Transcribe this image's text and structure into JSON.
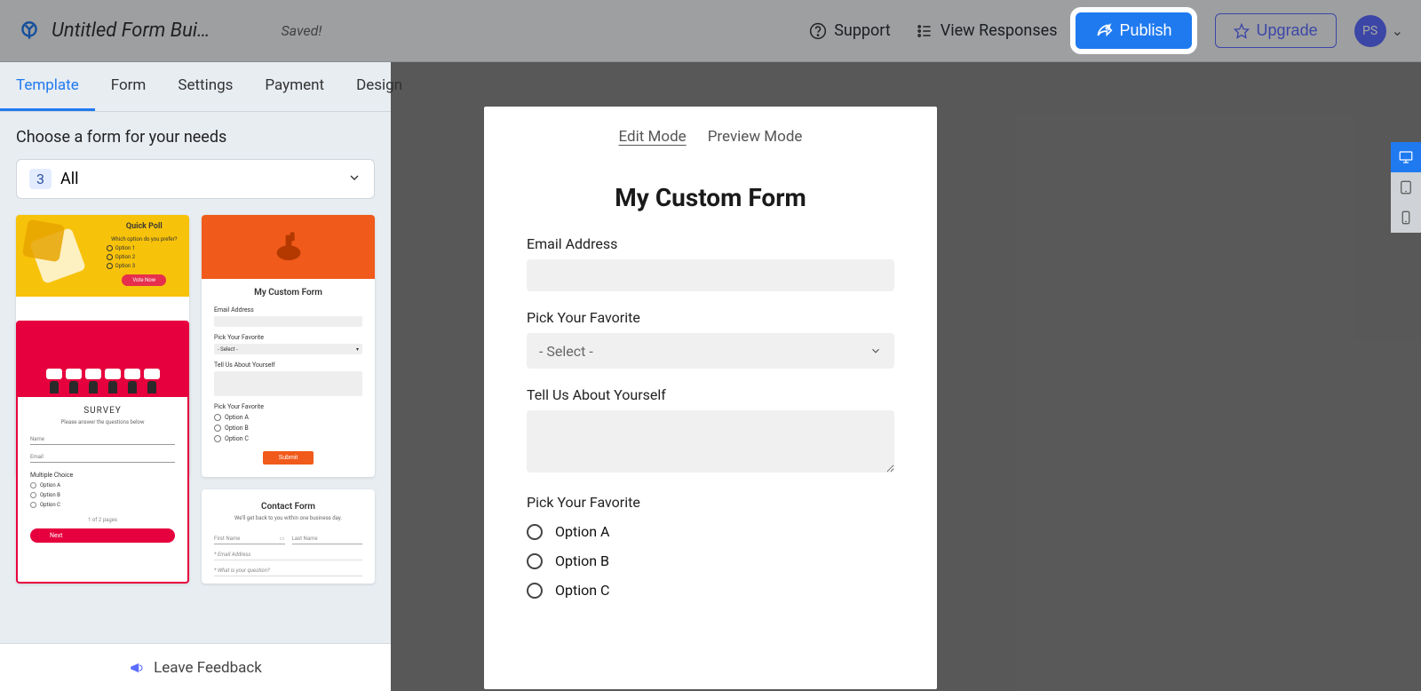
{
  "header": {
    "title": "Untitled Form Bui…",
    "saved": "Saved!",
    "support": "Support",
    "view_responses": "View Responses",
    "publish": "Publish",
    "upgrade": "Upgrade",
    "avatar_initials": "PS"
  },
  "sidebar": {
    "tabs": [
      "Template",
      "Form",
      "Settings",
      "Payment",
      "Design"
    ],
    "active_tab_index": 0,
    "section_title": "Choose a form for your needs",
    "filter": {
      "count": "3",
      "label": "All"
    },
    "templates": {
      "poll": {
        "title": "Quick Poll",
        "question": "Which option do you prefer?",
        "options": [
          "Option 1",
          "Option 2",
          "Option 3"
        ],
        "button": "Vote Now"
      },
      "custom": {
        "title": "My Custom Form",
        "f1": "Email Address",
        "f2": "Pick Your Favorite",
        "select_placeholder": "- Select -",
        "f3": "Tell Us About Yourself",
        "f4": "Pick Your Favorite",
        "radios": [
          "Option A",
          "Option B",
          "Option C"
        ],
        "submit": "Submit"
      },
      "survey": {
        "title": "SURVEY",
        "subtitle": "Please answer the questions below",
        "name": "Name",
        "email": "Email",
        "mc": "Multiple Choice",
        "radios": [
          "Option A",
          "Option B",
          "Option C"
        ],
        "pagination": "1 of 2 pages",
        "next": "Next"
      },
      "contact": {
        "title": "Contact Form",
        "subtitle": "We'll get back to you within one business day.",
        "first_name": "First Name",
        "last_name": "Last Name",
        "email": "* Email Address",
        "question": "* What is your question?"
      }
    },
    "feedback": "Leave Feedback"
  },
  "canvas": {
    "modes": [
      "Edit Mode",
      "Preview Mode"
    ],
    "active_mode_index": 0,
    "form_title": "My Custom Form",
    "fields": {
      "email_label": "Email Address",
      "fav_label": "Pick Your Favorite",
      "select_placeholder": "- Select -",
      "about_label": "Tell Us About Yourself",
      "fav2_label": "Pick Your Favorite",
      "radios": [
        "Option A",
        "Option B",
        "Option C"
      ]
    }
  },
  "viewport": {
    "active_index": 0
  }
}
